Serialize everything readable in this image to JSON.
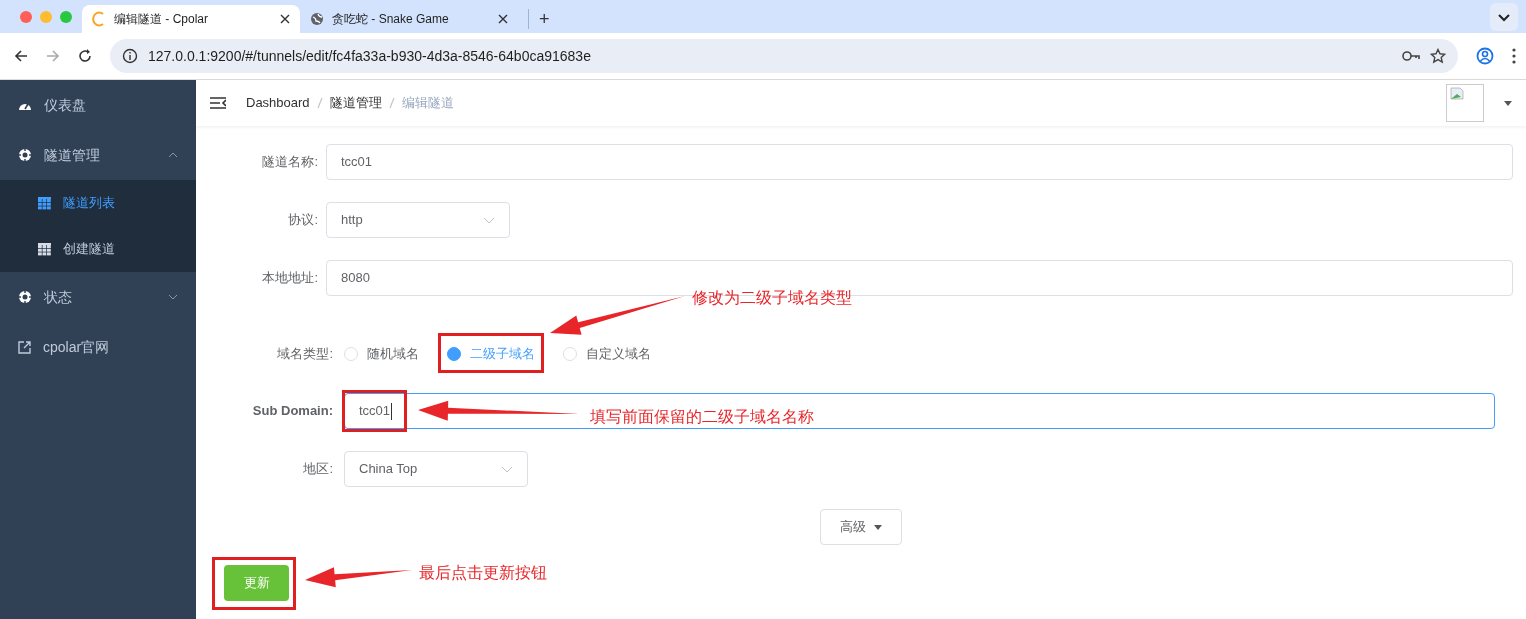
{
  "browser": {
    "tabs": [
      {
        "title": "编辑隧道 - Cpolar",
        "selected": true
      },
      {
        "title": "贪吃蛇 - Snake Game",
        "selected": false
      }
    ],
    "new_tab": "+",
    "url": "127.0.0.1:9200/#/tunnels/edit/fc4fa33a-b930-4d3a-8546-64b0ca91683e"
  },
  "sidebar": {
    "items": [
      {
        "label": "仪表盘",
        "kind": "dashboard"
      },
      {
        "label": "隧道管理",
        "kind": "group",
        "expanded": true,
        "children": [
          {
            "label": "隧道列表",
            "selected": true
          },
          {
            "label": "创建隧道",
            "selected": false
          }
        ]
      },
      {
        "label": "状态",
        "kind": "group",
        "expanded": false
      },
      {
        "label": "cpolar官网",
        "kind": "external"
      }
    ]
  },
  "breadcrumb": [
    {
      "label": "Dashboard",
      "current": false
    },
    {
      "label": "隧道管理",
      "current": false
    },
    {
      "label": "编辑隧道",
      "current": true
    }
  ],
  "form": {
    "fields": [
      {
        "label": "隧道名称:",
        "kind": "text",
        "value": "tcc01"
      },
      {
        "label": "协议:",
        "kind": "select",
        "value": "http"
      },
      {
        "label": "本地地址:",
        "kind": "text",
        "value": "8080"
      },
      {
        "label": "域名类型:",
        "kind": "radio",
        "options": [
          {
            "label": "随机域名",
            "selected": false
          },
          {
            "label": "二级子域名",
            "selected": true
          },
          {
            "label": "自定义域名",
            "selected": false
          }
        ]
      },
      {
        "label": "Sub Domain:",
        "kind": "text",
        "value": "tcc01",
        "focused": true
      },
      {
        "label": "地区:",
        "kind": "select",
        "value": "China Top"
      }
    ],
    "advanced": "高级",
    "submit": "更新"
  },
  "annotations": [
    {
      "text": "修改为二级子域名类型"
    },
    {
      "text": "填写前面保留的二级子域名名称"
    },
    {
      "text": "最后点击更新按钮"
    }
  ]
}
